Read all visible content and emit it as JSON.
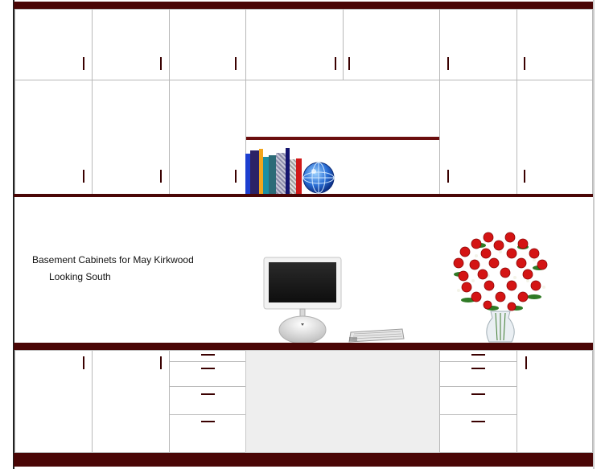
{
  "drawing": {
    "title": "Basement Cabinets for May Kirkwood",
    "subtitle": "Looking South"
  },
  "colors": {
    "trim": "#4a0606",
    "door_outline": "#b8b8b8",
    "opening_fill": "#eeeeee",
    "handle": "#3a0000"
  },
  "icons": [
    "books-icon",
    "globe-icon",
    "imac-computer-icon",
    "keyboard-icon",
    "rose-vase-icon"
  ]
}
